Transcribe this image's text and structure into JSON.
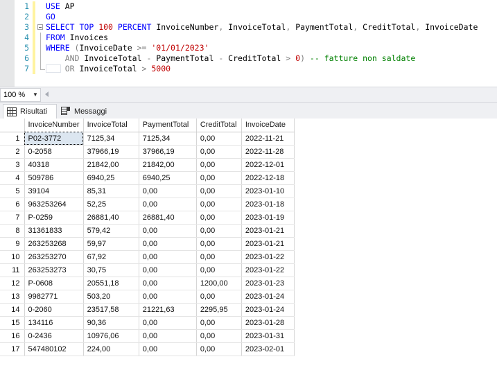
{
  "editor": {
    "zoom_level": "100 %",
    "lines": [
      {
        "n": "1",
        "tokens": [
          {
            "t": "USE",
            "c": "k"
          },
          {
            "t": " ",
            "c": "pn"
          },
          {
            "t": "AP",
            "c": "id"
          }
        ]
      },
      {
        "n": "2",
        "tokens": [
          {
            "t": "GO",
            "c": "k"
          }
        ]
      },
      {
        "n": "3",
        "tokens": [
          {
            "t": "SELECT",
            "c": "k"
          },
          {
            "t": " ",
            "c": "pn"
          },
          {
            "t": "TOP",
            "c": "k"
          },
          {
            "t": " ",
            "c": "pn"
          },
          {
            "t": "100",
            "c": "num"
          },
          {
            "t": " ",
            "c": "pn"
          },
          {
            "t": "PERCENT",
            "c": "k"
          },
          {
            "t": " ",
            "c": "pn"
          },
          {
            "t": "InvoiceNumber",
            "c": "id"
          },
          {
            "t": ",",
            "c": "op"
          },
          {
            "t": " ",
            "c": "pn"
          },
          {
            "t": "InvoiceTotal",
            "c": "id"
          },
          {
            "t": ",",
            "c": "op"
          },
          {
            "t": " ",
            "c": "pn"
          },
          {
            "t": "PaymentTotal",
            "c": "id"
          },
          {
            "t": ",",
            "c": "op"
          },
          {
            "t": " ",
            "c": "pn"
          },
          {
            "t": "CreditTotal",
            "c": "id"
          },
          {
            "t": ",",
            "c": "op"
          },
          {
            "t": " ",
            "c": "pn"
          },
          {
            "t": "InvoiceDate",
            "c": "id"
          }
        ]
      },
      {
        "n": "4",
        "tokens": [
          {
            "t": "FROM",
            "c": "k"
          },
          {
            "t": " ",
            "c": "pn"
          },
          {
            "t": "Invoices",
            "c": "id"
          }
        ]
      },
      {
        "n": "5",
        "tokens": [
          {
            "t": "WHERE",
            "c": "k"
          },
          {
            "t": " (",
            "c": "op"
          },
          {
            "t": "InvoiceDate",
            "c": "id"
          },
          {
            "t": " >= ",
            "c": "op"
          },
          {
            "t": "'01/01/2023'",
            "c": "str"
          }
        ]
      },
      {
        "n": "6",
        "tokens": [
          {
            "t": "    ",
            "c": "pn"
          },
          {
            "t": "AND",
            "c": "op"
          },
          {
            "t": " ",
            "c": "pn"
          },
          {
            "t": "InvoiceTotal",
            "c": "id"
          },
          {
            "t": " - ",
            "c": "op"
          },
          {
            "t": "PaymentTotal",
            "c": "id"
          },
          {
            "t": " - ",
            "c": "op"
          },
          {
            "t": "CreditTotal",
            "c": "id"
          },
          {
            "t": " > ",
            "c": "op"
          },
          {
            "t": "0",
            "c": "num"
          },
          {
            "t": ") ",
            "c": "op"
          },
          {
            "t": "-- fatture non saldate",
            "c": "cm"
          }
        ]
      },
      {
        "n": "7",
        "tokens": [
          {
            "t": "    ",
            "c": "pn"
          },
          {
            "t": "OR",
            "c": "op"
          },
          {
            "t": " ",
            "c": "pn"
          },
          {
            "t": "InvoiceTotal",
            "c": "id"
          },
          {
            "t": " > ",
            "c": "op"
          },
          {
            "t": "5000",
            "c": "num"
          }
        ]
      }
    ]
  },
  "tabs": [
    {
      "label": "Risultati",
      "icon": "grid-icon",
      "active": true
    },
    {
      "label": "Messaggi",
      "icon": "message-icon",
      "active": false
    }
  ],
  "results": {
    "columns": [
      "InvoiceNumber",
      "InvoiceTotal",
      "PaymentTotal",
      "CreditTotal",
      "InvoiceDate"
    ],
    "rows": [
      {
        "n": "1",
        "InvoiceNumber": "P02-3772",
        "InvoiceTotal": "7125,34",
        "PaymentTotal": "7125,34",
        "CreditTotal": "0,00",
        "InvoiceDate": "2022-11-21"
      },
      {
        "n": "2",
        "InvoiceNumber": "0-2058",
        "InvoiceTotal": "37966,19",
        "PaymentTotal": "37966,19",
        "CreditTotal": "0,00",
        "InvoiceDate": "2022-11-28"
      },
      {
        "n": "3",
        "InvoiceNumber": "40318",
        "InvoiceTotal": "21842,00",
        "PaymentTotal": "21842,00",
        "CreditTotal": "0,00",
        "InvoiceDate": "2022-12-01"
      },
      {
        "n": "4",
        "InvoiceNumber": "509786",
        "InvoiceTotal": "6940,25",
        "PaymentTotal": "6940,25",
        "CreditTotal": "0,00",
        "InvoiceDate": "2022-12-18"
      },
      {
        "n": "5",
        "InvoiceNumber": "39104",
        "InvoiceTotal": "85,31",
        "PaymentTotal": "0,00",
        "CreditTotal": "0,00",
        "InvoiceDate": "2023-01-10"
      },
      {
        "n": "6",
        "InvoiceNumber": "963253264",
        "InvoiceTotal": "52,25",
        "PaymentTotal": "0,00",
        "CreditTotal": "0,00",
        "InvoiceDate": "2023-01-18"
      },
      {
        "n": "7",
        "InvoiceNumber": "P-0259",
        "InvoiceTotal": "26881,40",
        "PaymentTotal": "26881,40",
        "CreditTotal": "0,00",
        "InvoiceDate": "2023-01-19"
      },
      {
        "n": "8",
        "InvoiceNumber": "31361833",
        "InvoiceTotal": "579,42",
        "PaymentTotal": "0,00",
        "CreditTotal": "0,00",
        "InvoiceDate": "2023-01-21"
      },
      {
        "n": "9",
        "InvoiceNumber": "263253268",
        "InvoiceTotal": "59,97",
        "PaymentTotal": "0,00",
        "CreditTotal": "0,00",
        "InvoiceDate": "2023-01-21"
      },
      {
        "n": "10",
        "InvoiceNumber": "263253270",
        "InvoiceTotal": "67,92",
        "PaymentTotal": "0,00",
        "CreditTotal": "0,00",
        "InvoiceDate": "2023-01-22"
      },
      {
        "n": "11",
        "InvoiceNumber": "263253273",
        "InvoiceTotal": "30,75",
        "PaymentTotal": "0,00",
        "CreditTotal": "0,00",
        "InvoiceDate": "2023-01-22"
      },
      {
        "n": "12",
        "InvoiceNumber": "P-0608",
        "InvoiceTotal": "20551,18",
        "PaymentTotal": "0,00",
        "CreditTotal": "1200,00",
        "InvoiceDate": "2023-01-23"
      },
      {
        "n": "13",
        "InvoiceNumber": "9982771",
        "InvoiceTotal": "503,20",
        "PaymentTotal": "0,00",
        "CreditTotal": "0,00",
        "InvoiceDate": "2023-01-24"
      },
      {
        "n": "14",
        "InvoiceNumber": "0-2060",
        "InvoiceTotal": "23517,58",
        "PaymentTotal": "21221,63",
        "CreditTotal": "2295,95",
        "InvoiceDate": "2023-01-24"
      },
      {
        "n": "15",
        "InvoiceNumber": "134116",
        "InvoiceTotal": "90,36",
        "PaymentTotal": "0,00",
        "CreditTotal": "0,00",
        "InvoiceDate": "2023-01-28"
      },
      {
        "n": "16",
        "InvoiceNumber": "0-2436",
        "InvoiceTotal": "10976,06",
        "PaymentTotal": "0,00",
        "CreditTotal": "0,00",
        "InvoiceDate": "2023-01-31"
      },
      {
        "n": "17",
        "InvoiceNumber": "547480102",
        "InvoiceTotal": "224,00",
        "PaymentTotal": "0,00",
        "CreditTotal": "0,00",
        "InvoiceDate": "2023-02-01"
      }
    ],
    "selected_cell": {
      "row": 0,
      "column": "InvoiceNumber"
    }
  },
  "colors": {
    "keyword": "#0000ff",
    "string": "#c00000",
    "comment": "#008000",
    "operator": "#808080",
    "line_number": "#2b91af",
    "change_bar": "#fff3a0",
    "selection": "#dce6f0"
  }
}
